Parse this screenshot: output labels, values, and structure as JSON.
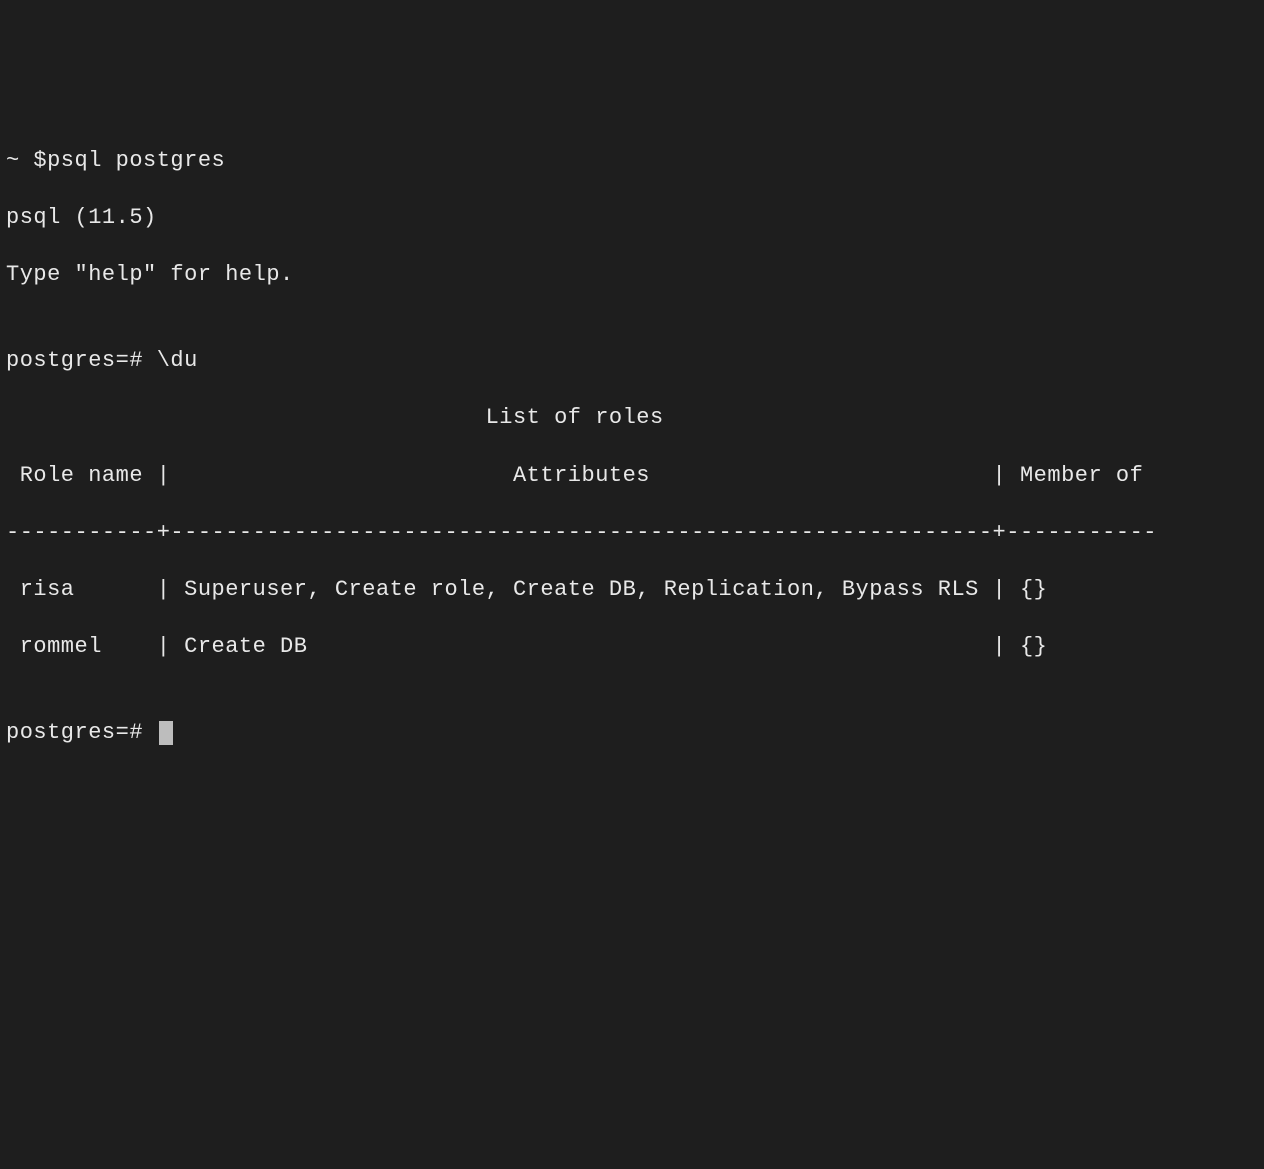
{
  "lines": {
    "cmd1": "~ $psql postgres",
    "v1": "psql (11.5)",
    "v2": "Type \"help\" for help.",
    "blank": "",
    "cmd2": "postgres=# \\du",
    "title": "                                   List of roles",
    "header": " Role name |                         Attributes                         | Member of ",
    "sep": "-----------+------------------------------------------------------------+-----------",
    "row1": " risa      | Superuser, Create role, Create DB, Replication, Bypass RLS | {}",
    "row2": " rommel    | Create DB                                                  | {}",
    "prompt": "postgres=# "
  }
}
